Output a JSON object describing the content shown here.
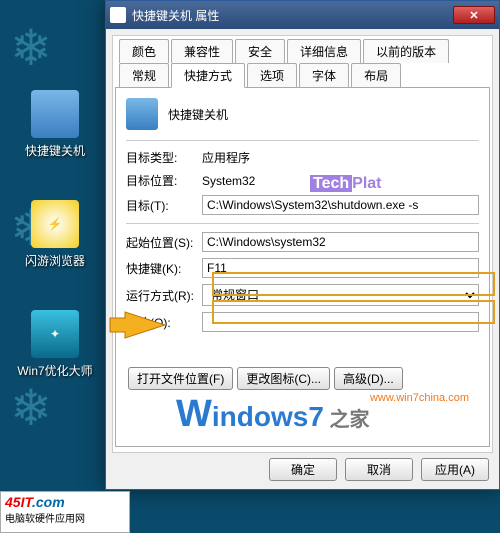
{
  "desktop": {
    "icons": [
      {
        "label": "快捷键关机"
      },
      {
        "label": "闪游浏览器"
      },
      {
        "label": "Win7优化大师"
      }
    ]
  },
  "dialog": {
    "title": "快捷键关机 属性",
    "tab_row1": [
      "颜色",
      "兼容性",
      "安全",
      "详细信息",
      "以前的版本"
    ],
    "tab_row2": [
      "常规",
      "快捷方式",
      "选项",
      "字体",
      "布局"
    ],
    "active_tab": "快捷方式",
    "header_name": "快捷键关机",
    "fields": {
      "target_type_label": "目标类型:",
      "target_type_value": "应用程序",
      "target_loc_label": "目标位置:",
      "target_loc_value": "System32",
      "target_label": "目标(T):",
      "target_value": "C:\\Windows\\System32\\shutdown.exe -s",
      "start_in_label": "起始位置(S):",
      "start_in_value": "C:\\Windows\\system32",
      "shortcut_label": "快捷键(K):",
      "shortcut_value": "F11",
      "run_label": "运行方式(R):",
      "run_value": "常规窗口",
      "comment_label": "备注(O):",
      "comment_value": ""
    },
    "buttons": {
      "open_loc": "打开文件位置(F)",
      "change_icon": "更改图标(C)...",
      "advanced": "高级(D)...",
      "ok": "确定",
      "cancel": "取消",
      "apply": "应用(A)"
    }
  },
  "watermarks": {
    "tech": "Tech",
    "plat": "Plat",
    "url": "www.win7china.com",
    "brand_w": "W",
    "brand_rest": "indows7",
    "brand_cn": " 之家"
  },
  "footer": {
    "brand1": "45IT",
    "brand2": ".com",
    "sub": "电脑软硬件应用网"
  }
}
